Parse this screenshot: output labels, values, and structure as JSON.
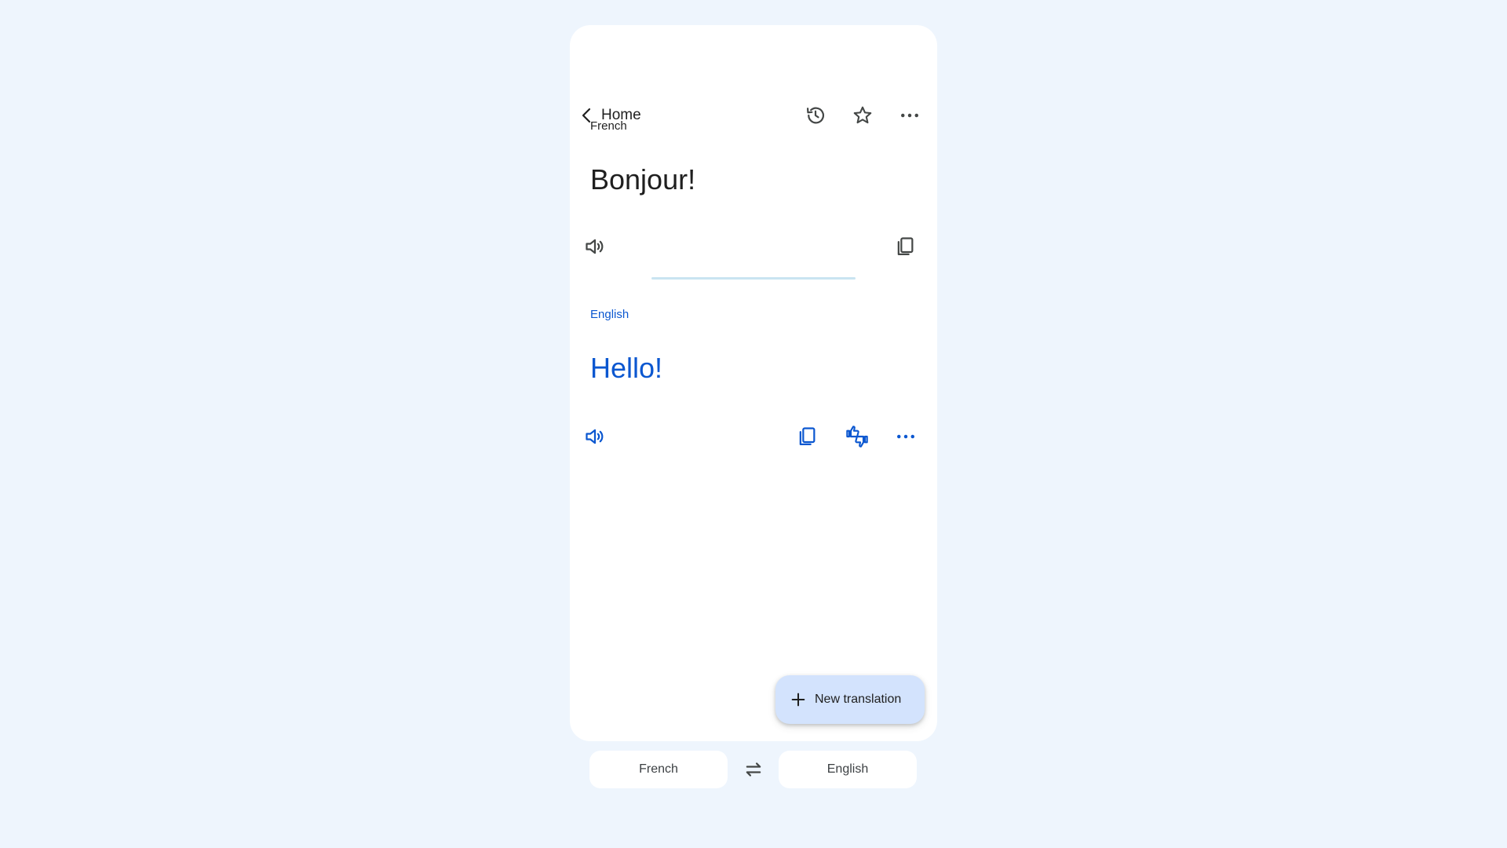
{
  "topbar": {
    "back_label": "Home",
    "icons": [
      "history-icon",
      "star-icon",
      "more-icon"
    ]
  },
  "source": {
    "language": "French",
    "text": "Bonjour!"
  },
  "target": {
    "language": "English",
    "text": "Hello!"
  },
  "fab": {
    "label": "New translation"
  },
  "language_bar": {
    "source_language": "French",
    "target_language": "English"
  },
  "colors": {
    "accent": "#0b57d0",
    "background": "#eef5fd",
    "fab": "#d3e3fd"
  }
}
